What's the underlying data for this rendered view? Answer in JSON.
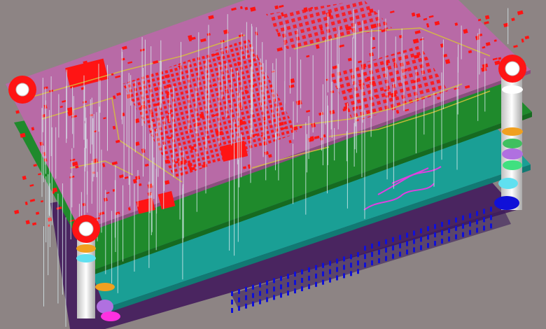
{
  "scene": {
    "subject": "pcb-layer-stackup-3d-view",
    "layers": [
      {
        "name": "top",
        "color": "#b86aa6"
      },
      {
        "name": "inner-1",
        "color": "#1f8a2c"
      },
      {
        "name": "inner-2",
        "color": "#1a9f95"
      },
      {
        "name": "bottom",
        "color": "#5b2a6a"
      }
    ],
    "colors": {
      "background": "#8d8484",
      "pad": "#ff1414",
      "trace_yellow": "#d8c23a",
      "trace_cyan": "#7fd6e6",
      "via": "#d9ecef",
      "trace_magenta": "#e040e0",
      "pad_blue": "#1010d8"
    },
    "icons": [
      "standoff-post-icon",
      "mounting-hole-icon"
    ]
  }
}
